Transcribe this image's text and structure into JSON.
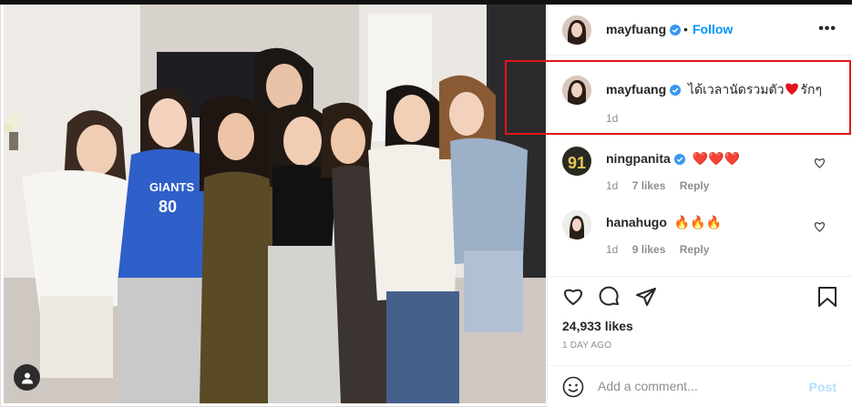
{
  "post": {
    "author": "mayfuang",
    "follow_label": "Follow",
    "separator": "•",
    "more_label": "•••"
  },
  "caption": {
    "username": "mayfuang",
    "text": "ได้เวลานัดรวมตัว",
    "text_after": "รักๆ",
    "time": "1d"
  },
  "comments": [
    {
      "username": "ningpanita",
      "text": "❤️❤️❤️",
      "time": "1d",
      "likes": "7 likes",
      "reply": "Reply"
    },
    {
      "username": "hanahugo",
      "text": "🔥🔥🔥",
      "time": "1d",
      "likes": "9 likes",
      "reply": "Reply"
    }
  ],
  "actions": {
    "likes": "24,933 likes",
    "ago": "1 DAY AGO"
  },
  "add_comment": {
    "placeholder": "Add a comment...",
    "post_label": "Post"
  },
  "icons": [
    "verified-badge-icon",
    "more-options-icon",
    "heart-icon",
    "comment-icon",
    "share-icon",
    "bookmark-icon",
    "emoji-icon",
    "tag-user-icon"
  ],
  "colors": {
    "link": "#0095f6",
    "highlight": "#e0161c",
    "post_disabled": "#b2dffc"
  }
}
